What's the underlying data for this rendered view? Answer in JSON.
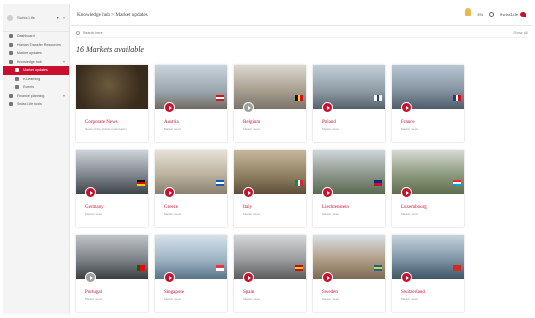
{
  "sidebar": {
    "selector_label": "Swiss Life",
    "items": [
      {
        "label": "Dashboard",
        "active": false,
        "sub": false
      },
      {
        "label": "Human Transfer Resources",
        "active": false,
        "sub": false
      },
      {
        "label": "Market updates",
        "active": false,
        "sub": false
      },
      {
        "label": "Knowledge hub",
        "active": false,
        "sub": false
      },
      {
        "label": "Market updates",
        "active": true,
        "sub": true
      },
      {
        "label": "e-Learning",
        "active": false,
        "sub": true
      },
      {
        "label": "Events",
        "active": false,
        "sub": true
      },
      {
        "label": "Finance planning",
        "active": false,
        "sub": false
      },
      {
        "label": "Swiss Life tools",
        "active": false,
        "sub": false
      }
    ]
  },
  "header": {
    "breadcrumb": "Knowledge hub > Market updates",
    "lang": "EN",
    "brand": "SwissLife"
  },
  "search": {
    "placeholder": "Search here",
    "show_label": "Show: All"
  },
  "page_title": "16 Markets available",
  "markets": [
    {
      "name": "Corporate News",
      "sub": "News of the global organisation",
      "pin": "none",
      "flag": [],
      "theme": "corp"
    },
    {
      "name": "Austria",
      "sub": "Market news",
      "pin": "red",
      "flag": [
        "#d7141a",
        "#ffffff",
        "#d7141a"
      ],
      "flag_dir": "h",
      "theme": "city1"
    },
    {
      "name": "Belgium",
      "sub": "Market news",
      "pin": "gray",
      "flag": [
        "#111111",
        "#f7d117",
        "#e30613"
      ],
      "flag_dir": "v",
      "theme": "city2"
    },
    {
      "name": "Poland",
      "sub": "Market news",
      "pin": "red",
      "flag": [
        "#ffffff",
        "#1b3d8f",
        "#ffffff"
      ],
      "flag_dir": "v",
      "theme": "city3"
    },
    {
      "name": "France",
      "sub": "Market news",
      "pin": "red",
      "flag": [
        "#1b3d8f",
        "#ffffff",
        "#e30613"
      ],
      "flag_dir": "v",
      "theme": "paris"
    },
    {
      "name": "Germany",
      "sub": "Market news",
      "pin": "red",
      "flag": [
        "#111111",
        "#dd0000",
        "#ffce00"
      ],
      "flag_dir": "h",
      "theme": "berlin"
    },
    {
      "name": "Greece",
      "sub": "Market news",
      "pin": "red",
      "flag": [
        "#0d5eaf",
        "#ffffff",
        "#0d5eaf"
      ],
      "flag_dir": "h",
      "theme": "athens"
    },
    {
      "name": "Italy",
      "sub": "Market news",
      "pin": "red",
      "flag": [
        "#009246",
        "#ffffff",
        "#ce2b37"
      ],
      "flag_dir": "v",
      "theme": "rome"
    },
    {
      "name": "Liechtenstein",
      "sub": "Market news",
      "pin": "red",
      "flag": [
        "#002b7f",
        "#ce1126"
      ],
      "flag_dir": "h",
      "theme": "castle"
    },
    {
      "name": "Luxembourg",
      "sub": "Market news",
      "pin": "red",
      "flag": [
        "#ed2939",
        "#ffffff",
        "#00a1de"
      ],
      "flag_dir": "h",
      "theme": "lux"
    },
    {
      "name": "Portugal",
      "sub": "Market news",
      "pin": "gray",
      "flag": [
        "#006600",
        "#ff0000",
        "#ff0000"
      ],
      "flag_dir": "v",
      "theme": "bridge"
    },
    {
      "name": "Singapore",
      "sub": "Market news",
      "pin": "red",
      "flag": [
        "#ef3340",
        "#ffffff"
      ],
      "flag_dir": "h",
      "theme": "sg"
    },
    {
      "name": "Spain",
      "sub": "Market news",
      "pin": "red",
      "flag": [
        "#c60b1e",
        "#ffc400",
        "#c60b1e"
      ],
      "flag_dir": "h",
      "theme": "madrid"
    },
    {
      "name": "Sweden",
      "sub": "Market news",
      "pin": "red",
      "flag": [
        "#006aa7",
        "#fecc00",
        "#006aa7"
      ],
      "flag_dir": "h",
      "theme": "sweden"
    },
    {
      "name": "Switzerland",
      "sub": "Market news",
      "pin": "red",
      "flag": [
        "#d52b1e"
      ],
      "flag_dir": "h",
      "theme": "swiss"
    }
  ],
  "colors": {
    "accent": "#c8102e",
    "pin_inactive": "#9e9e9e"
  }
}
